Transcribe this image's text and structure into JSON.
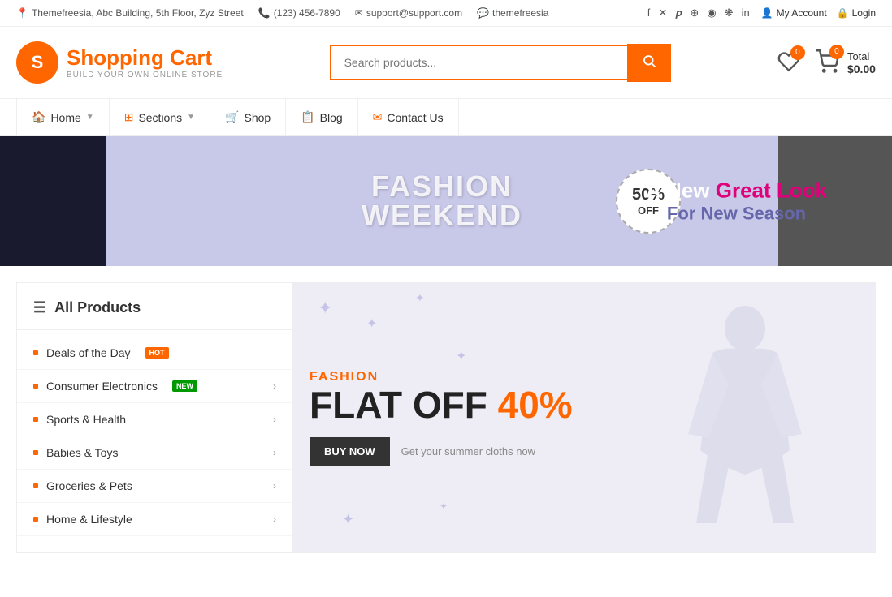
{
  "topbar": {
    "address": "Themefreesia, Abc Building, 5th Floor, Zyz Street",
    "phone": "(123) 456-7890",
    "email": "support@support.com",
    "skype": "themefreesia",
    "account_label": "My Account",
    "login_label": "Login"
  },
  "social": {
    "icons": [
      "f",
      "𝕏",
      "𝕡",
      "⊕",
      "✦",
      "✿",
      "in"
    ]
  },
  "header": {
    "logo_letter": "S",
    "logo_title": "Shopping Cart",
    "logo_subtitle": "BUILD YOUR OWN ONLINE STORE",
    "search_placeholder": "Search products...",
    "search_button_label": "🔍",
    "wishlist_count": "0",
    "cart_count": "0",
    "cart_total_label": "Total",
    "cart_total_value": "$0.00"
  },
  "nav": {
    "items": [
      {
        "label": "Home",
        "icon": "🏠",
        "has_arrow": true
      },
      {
        "label": "Sections",
        "icon": "⊞",
        "has_arrow": true
      },
      {
        "label": "Shop",
        "icon": "🛒",
        "has_arrow": false
      },
      {
        "label": "Blog",
        "icon": "📋",
        "has_arrow": false
      },
      {
        "label": "Contact Us",
        "icon": "✉",
        "has_arrow": false
      }
    ]
  },
  "hero": {
    "line1": "FASHION",
    "line2": "WEEKEND",
    "discount_pct": "50%",
    "discount_off": "OFF",
    "tagline_new": "A New",
    "tagline_great": "Great Look",
    "tagline_season": "For New Season"
  },
  "sidebar": {
    "header": "All Products",
    "items": [
      {
        "label": "Deals of the Day",
        "badge": "HOT",
        "badge_type": "hot",
        "has_arrow": false
      },
      {
        "label": "Consumer Electronics",
        "badge": "NEW",
        "badge_type": "new",
        "has_arrow": true
      },
      {
        "label": "Sports & Health",
        "badge": "",
        "badge_type": "",
        "has_arrow": true
      },
      {
        "label": "Babies & Toys",
        "badge": "",
        "badge_type": "",
        "has_arrow": true
      },
      {
        "label": "Groceries & Pets",
        "badge": "",
        "badge_type": "",
        "has_arrow": true
      },
      {
        "label": "Home & Lifestyle",
        "badge": "",
        "badge_type": "",
        "has_arrow": true
      }
    ]
  },
  "banner": {
    "fashion_label": "FASHION",
    "headline1": "FLAT OFF 40%",
    "cta_button": "BUY NOW",
    "description": "Get your summer cloths now"
  },
  "stars": [
    "✦",
    "✦",
    "✦",
    "✦",
    "✦",
    "✦",
    "✦",
    "✦",
    "✦",
    "✦",
    "✦",
    "✦"
  ]
}
